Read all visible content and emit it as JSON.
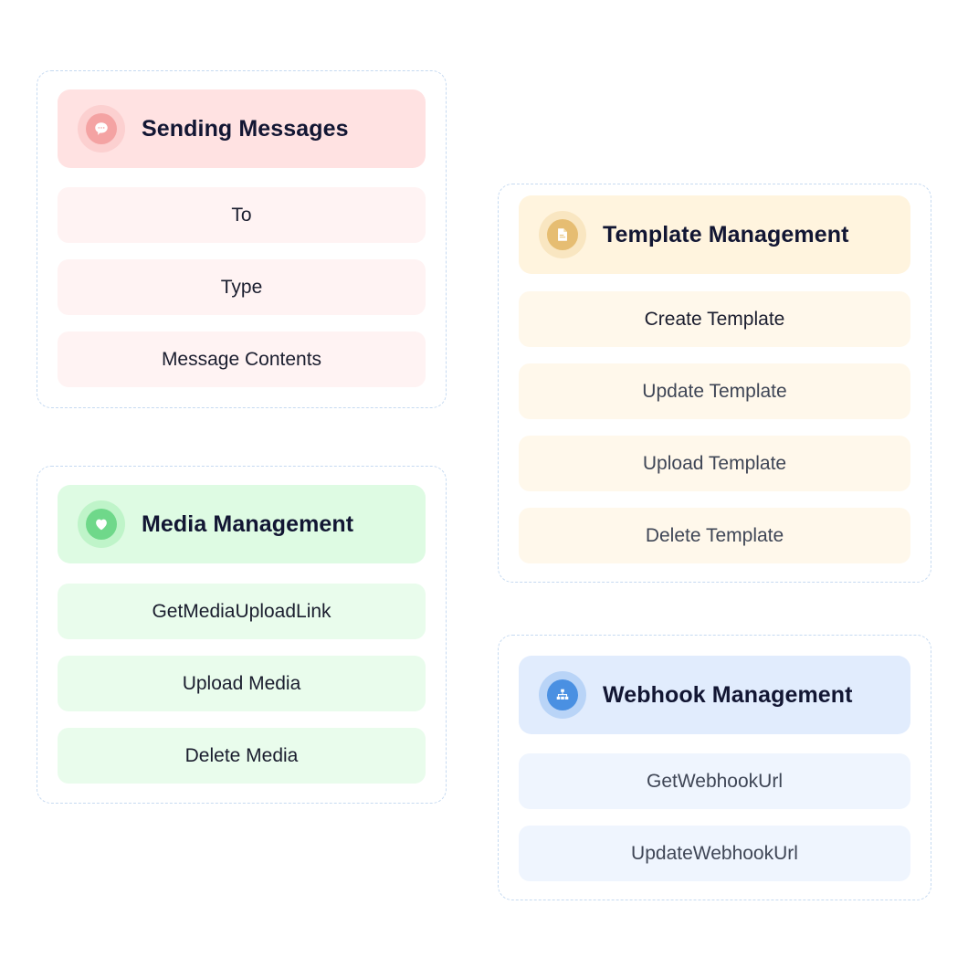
{
  "groups": {
    "sending": {
      "title": "Sending Messages",
      "icon": "chat-bubble-icon",
      "accent": "#f4a3a3",
      "items": [
        "To",
        "Type",
        "Message Contents"
      ]
    },
    "template": {
      "title": "Template Management",
      "icon": "document-icon",
      "accent": "#e6bd72",
      "items": [
        "Create Template",
        "Update Template",
        "Upload Template",
        "Delete Template"
      ]
    },
    "media": {
      "title": "Media Management",
      "icon": "heart-icon",
      "accent": "#6fd88a",
      "items": [
        "GetMediaUploadLink",
        "Upload Media",
        "Delete Media"
      ]
    },
    "webhook": {
      "title": "Webhook Management",
      "icon": "sitemap-icon",
      "accent": "#4a90e2",
      "items": [
        "GetWebhookUrl",
        "UpdateWebhookUrl"
      ]
    }
  }
}
